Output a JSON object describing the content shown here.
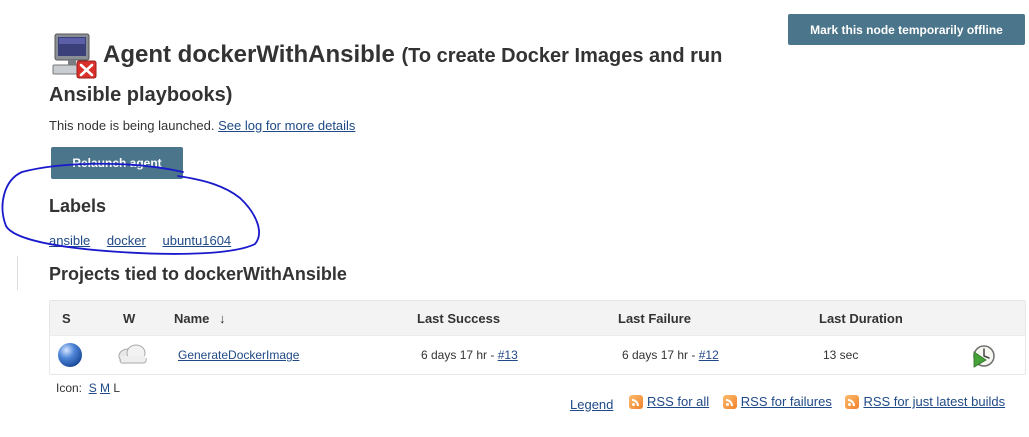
{
  "header": {
    "offline_button": "Mark this node temporarily offline",
    "title_name": "Agent dockerWithAnsible",
    "title_desc": "(To create Docker Images and run Ansible playbooks)"
  },
  "status": {
    "message": "This node is being launched.",
    "log_link": "See log for more details",
    "relaunch_button": "Relaunch agent"
  },
  "labels": {
    "heading": "Labels",
    "items": [
      "ansible",
      "docker",
      "ubuntu1604"
    ]
  },
  "projects": {
    "heading": "Projects tied to dockerWithAnsible",
    "columns": {
      "s": "S",
      "w": "W",
      "name": "Name",
      "sort_arrow": "↓",
      "last_success": "Last Success",
      "last_failure": "Last Failure",
      "last_duration": "Last Duration"
    },
    "rows": [
      {
        "status_icon": "blue-ball-icon",
        "weather_icon": "cloudy-weather-icon",
        "name": "GenerateDockerImage",
        "last_success_time": "6 days 17 hr - ",
        "last_success_build": "#13",
        "last_failure_time": "6 days 17 hr - ",
        "last_failure_build": "#12",
        "last_duration": "13 sec",
        "action_icon": "schedule-build-icon"
      }
    ]
  },
  "icon_size": {
    "label": "Icon:",
    "options": [
      "S",
      "M",
      "L"
    ],
    "selected": "L"
  },
  "footer": {
    "legend": "Legend",
    "rss_all": "RSS for all",
    "rss_failures": "RSS for failures",
    "rss_latest": "RSS for just latest builds"
  },
  "colors": {
    "button_bg": "#4b758b",
    "link": "#204a87",
    "annotation": "#1a1acc",
    "offline_badge": "#d9302c"
  }
}
